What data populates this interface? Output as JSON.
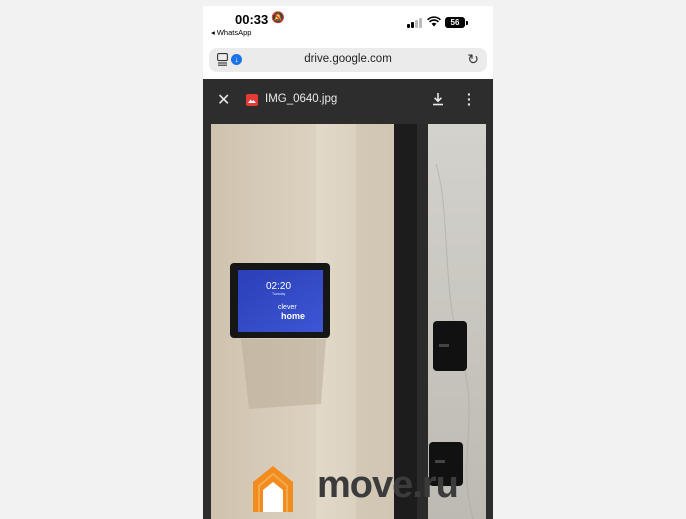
{
  "status_bar": {
    "time": "00:33",
    "back_app": "◂ WhatsApp",
    "battery": "56"
  },
  "browser": {
    "url": "drive.google.com"
  },
  "viewer": {
    "file_name": "IMG_0640.jpg"
  },
  "photo": {
    "screen_time": "02:20",
    "screen_subtext": "Tuesday",
    "screen_brand_line1": "clever",
    "screen_brand_line2": "home",
    "watermark": "move.ru"
  },
  "colors": {
    "accent_blue": "#1a73e8",
    "file_icon_red": "#e53935",
    "watermark_orange": "#f28c1e"
  }
}
